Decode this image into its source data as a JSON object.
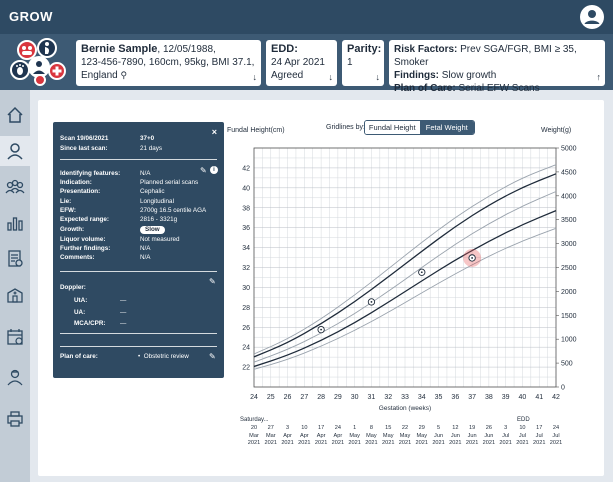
{
  "app": {
    "title": "GROW"
  },
  "patient": {
    "name": "Bernie Sample",
    "details_line1": ", 12/05/1988,",
    "details_line2": "123-456-7890, 160cm, 95kg, BMI 37.1,",
    "details_line3": "England"
  },
  "edd": {
    "label": "EDD:",
    "date": "24 Apr 2021",
    "status": "Agreed"
  },
  "parity": {
    "label": "Parity:",
    "value": "1"
  },
  "risk": {
    "risk_label": "Risk Factors:",
    "risk_value": "Prev SGA/FGR, BMI ≥ 35, Smoker",
    "findings_label": "Findings:",
    "findings_value": "Slow growth",
    "plan_label": "Plan of Care:",
    "plan_value": "Serial EFW Scans"
  },
  "scan": {
    "title": "Scan 19/06/2021",
    "gest": "37+0",
    "since_label": "Since last scan:",
    "since_value": "21 days",
    "fields": [
      {
        "k": "Identifying features:",
        "v": "N/A"
      },
      {
        "k": "Indication:",
        "v": "Planned serial scans"
      },
      {
        "k": "Presentation:",
        "v": "Cephalic"
      },
      {
        "k": "Lie:",
        "v": "Longitudinal"
      },
      {
        "k": "EFW:",
        "v": "2700g  16.5 centile  AGA"
      },
      {
        "k": "Expected range:",
        "v": "2816 - 3321g"
      },
      {
        "k": "Growth:",
        "v": "Slow"
      },
      {
        "k": "Liquor volume:",
        "v": "Not measured"
      },
      {
        "k": "Further findings:",
        "v": "N/A"
      },
      {
        "k": "Comments:",
        "v": "N/A"
      }
    ],
    "doppler_label": "Doppler:",
    "doppler": [
      {
        "k": "UtA:",
        "v": "—"
      },
      {
        "k": "UA:",
        "v": "—"
      },
      {
        "k": "MCA/CPR:",
        "v": "—"
      }
    ],
    "plan_label": "Plan of care:",
    "plan_value": "Obstetric review"
  },
  "chart_controls": {
    "gridlines_label": "Gridlines by:",
    "option_fundal": "Fundal Height",
    "option_fetal": "Fetal Weight"
  },
  "chart_data": {
    "type": "line",
    "title": "",
    "y_left_label": "Fundal Height(cm)",
    "y_right_label": "Weight(g)",
    "xlabel": "Gestation (weeks)",
    "x_ticks": [
      24,
      25,
      26,
      27,
      28,
      29,
      30,
      31,
      32,
      33,
      34,
      35,
      36,
      37,
      38,
      39,
      40,
      41,
      42
    ],
    "xlim": [
      24,
      42
    ],
    "y_left_ticks": [
      22,
      24,
      26,
      28,
      30,
      32,
      34,
      36,
      38,
      40,
      42
    ],
    "y_left_lim": [
      20,
      44
    ],
    "y_right_ticks": [
      0,
      500,
      1000,
      1500,
      2000,
      2500,
      3000,
      3500,
      4000,
      4500,
      5000
    ],
    "y_right_lim": [
      0,
      5000
    ],
    "series": [
      {
        "x": [
          24,
          26,
          28,
          30,
          32,
          34,
          36,
          38,
          40,
          42
        ],
        "y": [
          520,
          780,
          1120,
          1530,
          2000,
          2500,
          2990,
          3420,
          3790,
          4090
        ],
        "axis": "right",
        "style": "outer"
      },
      {
        "x": [
          24,
          26,
          28,
          30,
          32,
          34,
          36,
          38,
          40,
          42
        ],
        "y": [
          690,
          1000,
          1420,
          1920,
          2470,
          3030,
          3550,
          4000,
          4380,
          4650
        ],
        "axis": "right",
        "style": "outer"
      },
      {
        "x": [
          24,
          26,
          28,
          30,
          32,
          34,
          36,
          38,
          40,
          42
        ],
        "y": [
          630,
          920,
          1320,
          1780,
          2300,
          2840,
          3360,
          3810,
          4180,
          4460
        ],
        "axis": "right",
        "style": "main"
      },
      {
        "x": [
          24,
          26,
          28,
          30,
          32,
          34,
          36,
          38,
          40,
          42
        ],
        "y": [
          430,
          660,
          970,
          1340,
          1770,
          2220,
          2660,
          3050,
          3400,
          3690
        ],
        "axis": "right",
        "style": "main"
      },
      {
        "x": [
          24,
          26,
          28,
          30,
          32,
          34,
          36,
          38,
          40,
          42
        ],
        "y": [
          370,
          570,
          850,
          1180,
          1560,
          1970,
          2370,
          2740,
          3060,
          3320
        ],
        "axis": "right",
        "style": "outer"
      }
    ],
    "points": [
      {
        "x": 28,
        "y": 1200,
        "highlight": false
      },
      {
        "x": 31,
        "y": 1780,
        "highlight": false
      },
      {
        "x": 34,
        "y": 2400,
        "highlight": false
      },
      {
        "x": 37,
        "y": 2700,
        "highlight": true
      }
    ],
    "grid": true
  },
  "date_axis": {
    "header": "Saturday...",
    "edd_label": "EDD",
    "dates": [
      {
        "d": "20",
        "m": "Mar",
        "y": "2021"
      },
      {
        "d": "27",
        "m": "Mar",
        "y": "2021"
      },
      {
        "d": "3",
        "m": "Apr",
        "y": "2021"
      },
      {
        "d": "10",
        "m": "Apr",
        "y": "2021"
      },
      {
        "d": "17",
        "m": "Apr",
        "y": "2021"
      },
      {
        "d": "24",
        "m": "Apr",
        "y": "2021"
      },
      {
        "d": "1",
        "m": "May",
        "y": "2021"
      },
      {
        "d": "8",
        "m": "May",
        "y": "2021"
      },
      {
        "d": "15",
        "m": "May",
        "y": "2021"
      },
      {
        "d": "22",
        "m": "May",
        "y": "2021"
      },
      {
        "d": "29",
        "m": "May",
        "y": "2021"
      },
      {
        "d": "5",
        "m": "Jun",
        "y": "2021"
      },
      {
        "d": "12",
        "m": "Jun",
        "y": "2021"
      },
      {
        "d": "19",
        "m": "Jun",
        "y": "2021"
      },
      {
        "d": "26",
        "m": "Jun",
        "y": "2021"
      },
      {
        "d": "3",
        "m": "Jul",
        "y": "2021"
      },
      {
        "d": "10",
        "m": "Jul",
        "y": "2021"
      },
      {
        "d": "17",
        "m": "Jul",
        "y": "2021"
      },
      {
        "d": "24",
        "m": "Jul",
        "y": "2021"
      }
    ]
  },
  "colors": {
    "brand": "#2e4a63",
    "infobar": "#3d5a74",
    "sidebar": "#c2ccd6",
    "highlight": "#e85b5b"
  },
  "sidebar_icons": [
    "home-icon",
    "user-icon",
    "group-icon",
    "chart-icon",
    "report-icon",
    "hospital-icon",
    "calendar-icon",
    "nurse-icon",
    "printer-icon"
  ]
}
